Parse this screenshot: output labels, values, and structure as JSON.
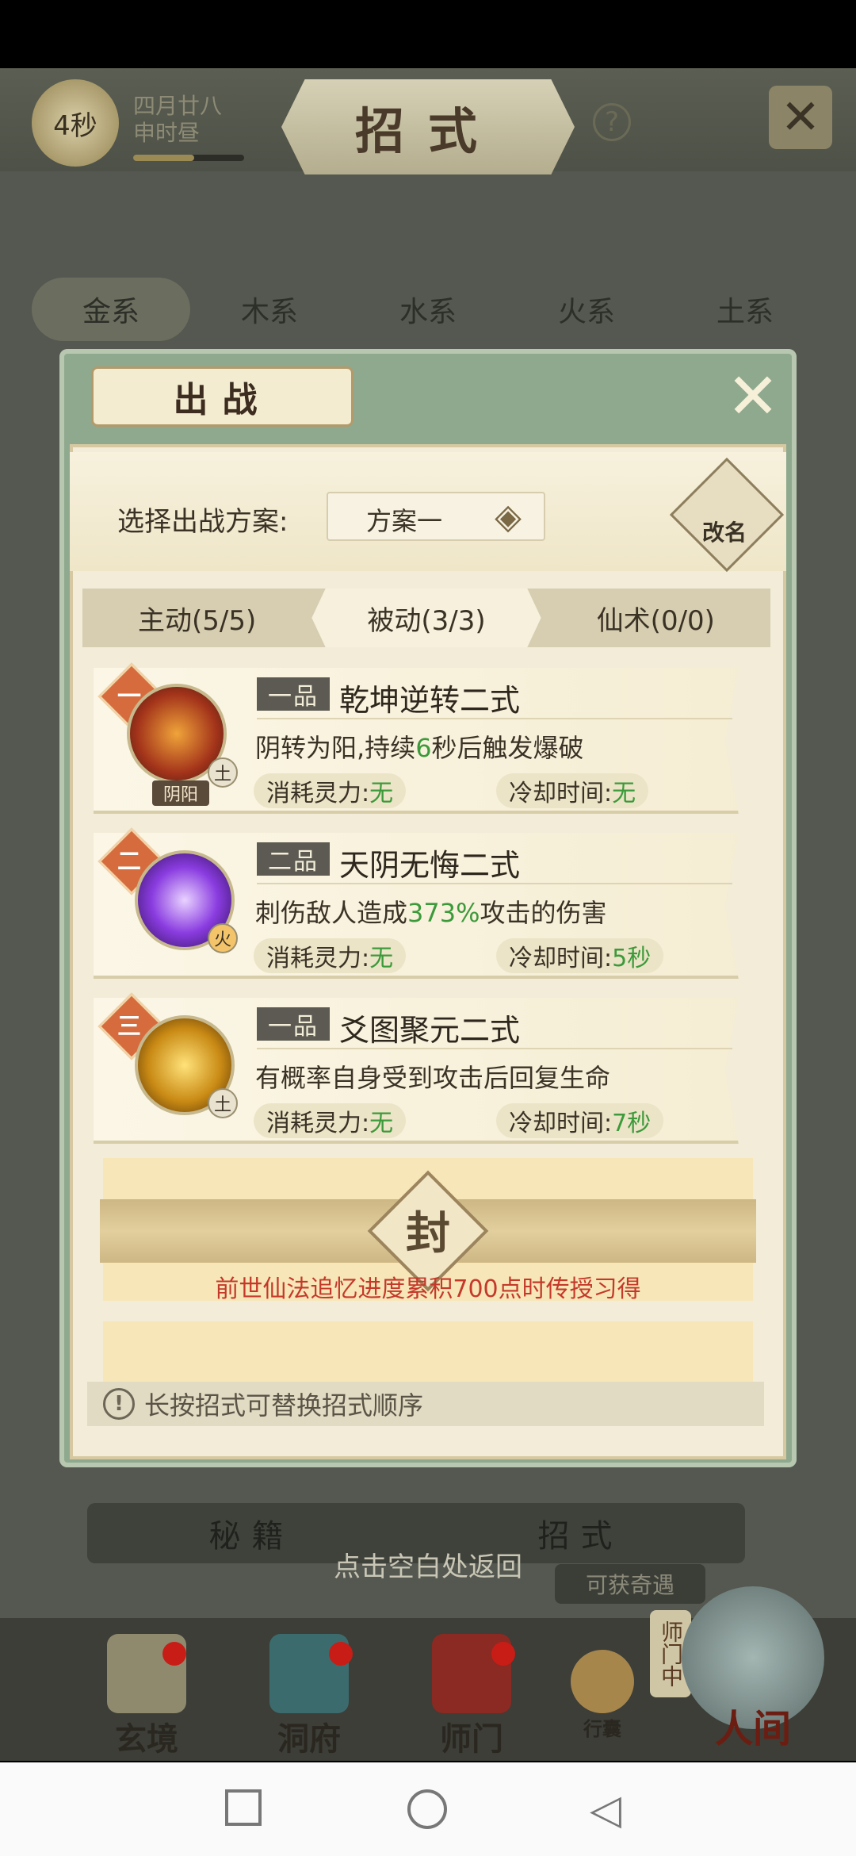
{
  "header": {
    "timer": "4秒",
    "date_line1": "四月廿八",
    "date_line2": "申时昼",
    "time_progress": 0.55,
    "title": "招式",
    "help_symbol": "?",
    "close_icon": "close-icon"
  },
  "element_tabs": [
    {
      "label": "金系",
      "active": true
    },
    {
      "label": "木系",
      "active": false
    },
    {
      "label": "水系",
      "active": false
    },
    {
      "label": "火系",
      "active": false
    },
    {
      "label": "土系",
      "active": false
    }
  ],
  "background": {
    "bottom_tabs": [
      "秘籍",
      "招式"
    ],
    "chance_badge": "可获奇遇",
    "nav": [
      {
        "label": "玄境",
        "icon": "scroll-icon",
        "dot": true
      },
      {
        "label": "洞府",
        "icon": "pavilion-icon",
        "dot": true
      },
      {
        "label": "师门",
        "icon": "banner-icon",
        "dot": true
      },
      {
        "label": "行囊",
        "icon": "bag-icon",
        "dot": false
      }
    ],
    "shimen_tag": "师门中",
    "world_label": "人间"
  },
  "modal": {
    "title": "出战",
    "plan_label": "选择出战方案:",
    "plan_value": "方案一",
    "rename_label": "改名",
    "skill_tabs": [
      {
        "label": "主动(5/5)",
        "active": false
      },
      {
        "label": "被动(3/3)",
        "active": true
      },
      {
        "label": "仙术(0/0)",
        "active": false
      }
    ],
    "skills": [
      {
        "rank": "一",
        "grade": "一品",
        "name": "乾坤逆转二式",
        "desc_pre": "阴转为阳,持续",
        "desc_hl": "6",
        "desc_post": "秒后触发爆破",
        "cost_label": "消耗灵力:",
        "cost_value": "无",
        "cd_label": "冷却时间:",
        "cd_value": "无",
        "element": "土",
        "tag": "阴阳",
        "icon_color": "#b5481c"
      },
      {
        "rank": "二",
        "grade": "二品",
        "name": "天阴无悔二式",
        "desc_pre": "刺伤敌人造成",
        "desc_hl": "373%",
        "desc_post": "攻击的伤害",
        "cost_label": "消耗灵力:",
        "cost_value": "无",
        "cd_label": "冷却时间:",
        "cd_value": "5秒",
        "element": "火",
        "tag": "",
        "icon_color": "#7a2fd0"
      },
      {
        "rank": "三",
        "grade": "一品",
        "name": "爻图聚元二式",
        "desc_pre": "有概率自身受到攻击后回复生命",
        "desc_hl": "",
        "desc_post": "",
        "cost_label": "消耗灵力:",
        "cost_value": "无",
        "cd_label": "冷却时间:",
        "cd_value": "7秒",
        "element": "土",
        "tag": "",
        "icon_color": "#c98a14"
      }
    ],
    "sealed_glyph": "封",
    "sealed_note": "前世仙法追忆进度累积700点时传授习得",
    "hint": "长按招式可替换招式顺序",
    "hint_icon": "!"
  },
  "tap_hint": "点击空白处返回",
  "colors": {
    "accent_green": "#3c9a3b",
    "seal_note_red": "#c4392a",
    "rank_orange": "#d66c3d"
  }
}
